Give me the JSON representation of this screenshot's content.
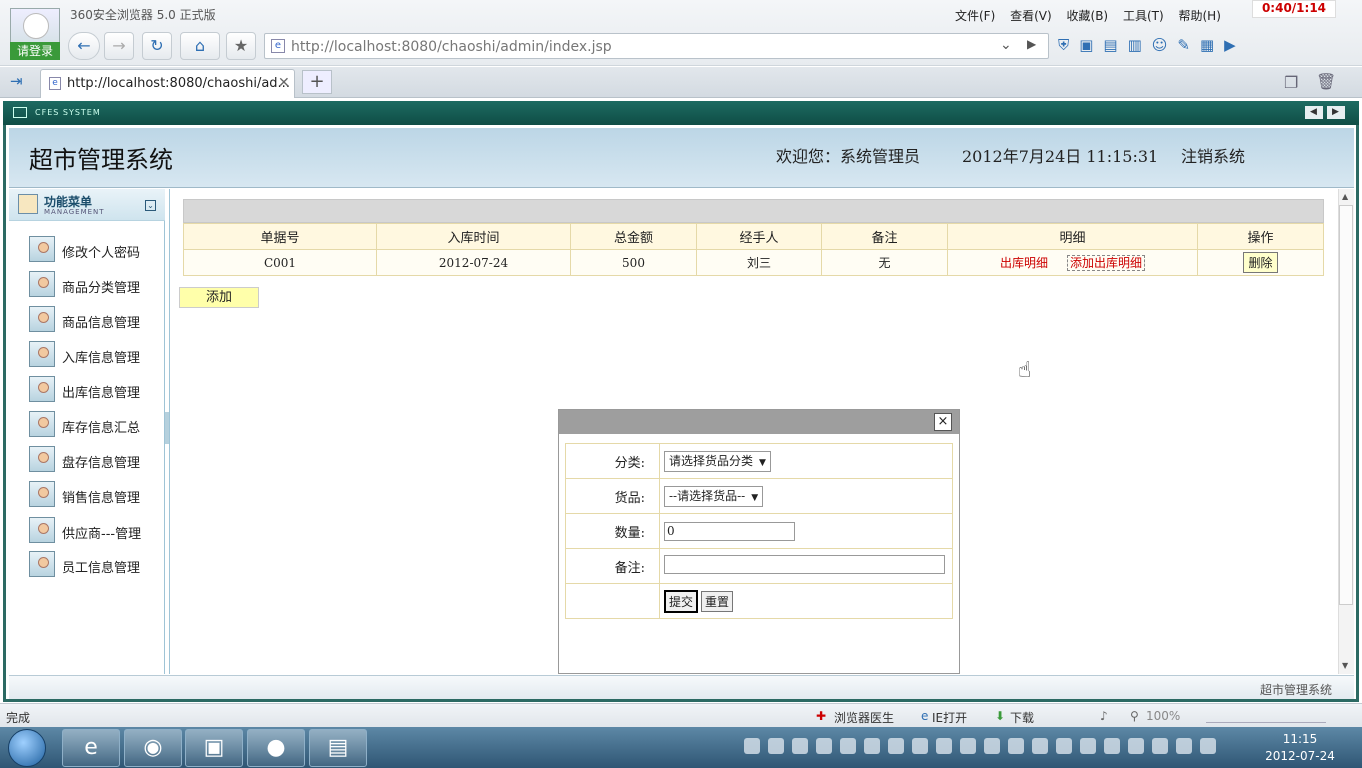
{
  "browser": {
    "brand": "360安全浏览器 5.0 正式版",
    "login": "请登录",
    "menu": [
      "文件(F)",
      "查看(V)",
      "收藏(B)",
      "工具(T)",
      "帮助(H)"
    ],
    "timer": "0:40/1:14",
    "address": "http://localhost:8080/chaoshi/admin/index.jsp",
    "tab_title": "http://localhost:8080/chaoshi/ad...",
    "status": "完成",
    "status_items": [
      "浏览器医生",
      "IE打开",
      "下载"
    ],
    "zoom": "100%"
  },
  "app": {
    "frame_title": "CFES SYSTEM",
    "title": "超市管理系统",
    "welcome": "欢迎您：系统管理员",
    "datetime": "2012年7月24日  11:15:31",
    "logout": "注销系统",
    "footer": "超市管理系统"
  },
  "sidebar": {
    "title": "功能菜单",
    "subtitle": "MANAGEMENT",
    "items": [
      {
        "label": "修改个人密码"
      },
      {
        "label": "商品分类管理"
      },
      {
        "label": "商品信息管理"
      },
      {
        "label": "入库信息管理"
      },
      {
        "label": "出库信息管理"
      },
      {
        "label": "库存信息汇总"
      },
      {
        "label": "盘存信息管理"
      },
      {
        "label": "销售信息管理"
      },
      {
        "label": "供应商---管理"
      },
      {
        "label": "员工信息管理"
      }
    ]
  },
  "table": {
    "headers": [
      "单据号",
      "入库时间",
      "总金额",
      "经手人",
      "备注",
      "明细",
      "操作"
    ],
    "rows": [
      {
        "id": "C001",
        "time": "2012-07-24",
        "amount": "500",
        "handler": "刘三",
        "note": "无",
        "detail_link": "出库明细",
        "add_link": "添加出库明细",
        "action": "删除"
      }
    ],
    "add_button": "添加"
  },
  "dialog": {
    "close": "×",
    "fields": {
      "category_label": "分类:",
      "category_value": "请选择货品分类",
      "goods_label": "货品:",
      "goods_value": "--请选择货品--",
      "qty_label": "数量:",
      "qty_value": "0",
      "note_label": "备注:",
      "note_value": ""
    },
    "submit": "提交",
    "reset": "重置"
  },
  "taskbar": {
    "time": "11:15",
    "date": "2012-07-24"
  },
  "colors": {
    "app_header": "#1d6b62",
    "banner": "#c8dde9",
    "link_red": "#cc0000",
    "add_button": "#ffffaa"
  }
}
